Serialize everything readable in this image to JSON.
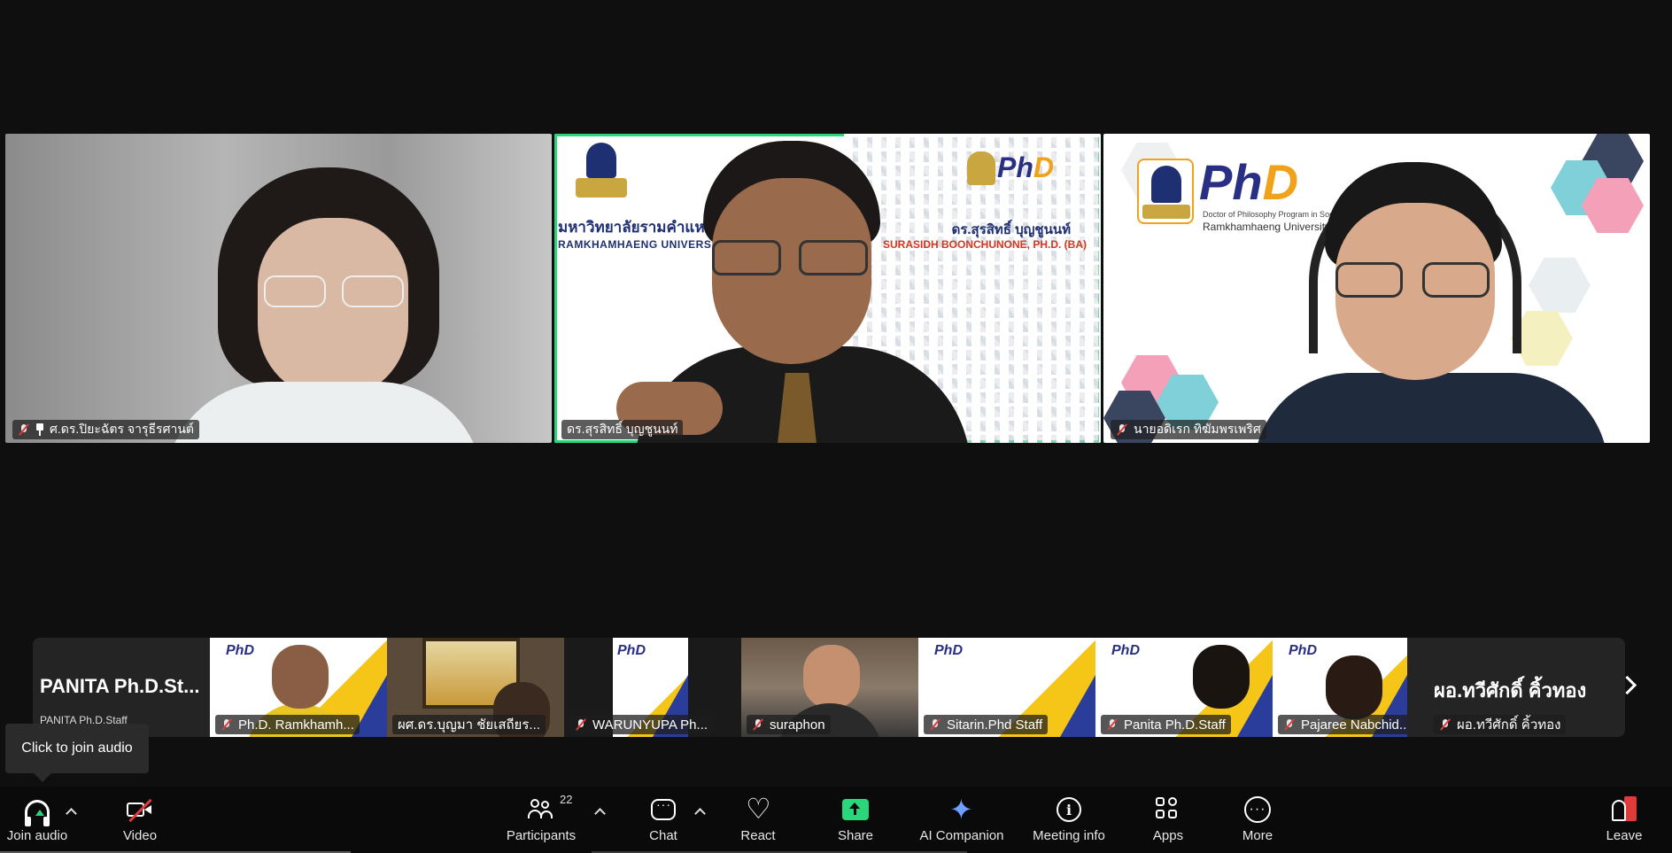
{
  "main_gallery": {
    "tiles": [
      {
        "name": "ศ.ดร.ปิยะฉัตร จารุธีรศานต์",
        "muted": true,
        "pinned": true
      },
      {
        "name": "ดร.สุรสิทธิ์ บุญชูนนท์",
        "muted": false,
        "active_speaker": true,
        "background": {
          "uni_th": "มหาวิทยาลัยรามคำแหง",
          "uni_en": "RAMKHAMHAENG UNIVERS",
          "speaker_th": "ดร.สุรสิทธิ์  บุญชูนนท์",
          "speaker_en": "SURASIDH BOONCHUNONE, PH.D. (BA)",
          "logo_p": "Ph",
          "logo_d": "D"
        }
      },
      {
        "name": "นายอดิเรก ทิฆัมพรเพริศ",
        "muted": true,
        "background": {
          "logo_p": "Ph",
          "logo_d": "D",
          "sub1": "Doctor of Philosophy Program in Social Sciences",
          "sub2": "Ramkhamhaeng University"
        }
      }
    ]
  },
  "thumbnail_strip": {
    "items": [
      {
        "big_name": "PANITA  Ph.D.St...",
        "name": "PANITA Ph.D.Staff",
        "type": "name-only"
      },
      {
        "name": "Ph.D. Ramkhamh...",
        "muted": true,
        "type": "video"
      },
      {
        "name": "ผศ.ดร.บุญมา ชัยเสถียร...",
        "muted": false,
        "type": "video"
      },
      {
        "name": "WARUNYUPA Ph...",
        "muted": true,
        "type": "video"
      },
      {
        "name": "suraphon",
        "muted": true,
        "type": "video"
      },
      {
        "name": "Sitarin.Phd Staff",
        "muted": true,
        "type": "video"
      },
      {
        "name": "Panita Ph.D.Staff",
        "muted": true,
        "type": "video"
      },
      {
        "name": "Pajaree Nabchid...",
        "muted": true,
        "type": "video"
      },
      {
        "big_name": "ผอ.ทวีศักดิ์  คิ้วทอง",
        "name": "ผอ.ทวีศักดิ์  คิ้วทอง",
        "muted": true,
        "type": "name-only"
      }
    ],
    "mini_logo": "PhD"
  },
  "tooltip": {
    "text": "Click to join audio"
  },
  "toolbar": {
    "join_audio": "Join audio",
    "video": "Video",
    "participants": "Participants",
    "participants_count": "22",
    "chat": "Chat",
    "react": "React",
    "share": "Share",
    "ai_companion": "AI Companion",
    "meeting_info": "Meeting info",
    "apps": "Apps",
    "more": "More",
    "leave": "Leave",
    "more_glyph": "···",
    "info_glyph": "i"
  },
  "colors": {
    "active_speaker_border": "#2bd67b",
    "share_green": "#2bd67b",
    "leave_red": "#e03b3b",
    "muted_red": "#e03b3b",
    "background": "#0f0f0f"
  },
  "icons": [
    "headphones-icon",
    "video-off-icon",
    "participants-icon",
    "chat-icon",
    "react-heart-icon",
    "share-screen-icon",
    "ai-companion-sparkle-icon",
    "info-icon",
    "apps-icon",
    "more-icon",
    "leave-icon",
    "mic-muted-icon",
    "pin-icon",
    "chevron-right-icon",
    "chevron-up-icon"
  ]
}
